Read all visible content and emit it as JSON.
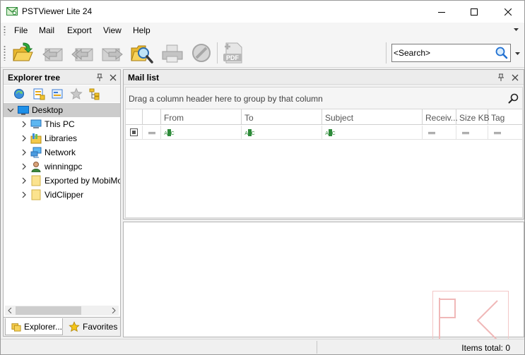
{
  "window": {
    "title": "PSTViewer Lite 24",
    "controls": [
      "minimize-icon",
      "maximize-icon",
      "close-icon"
    ]
  },
  "menu": {
    "items": [
      "File",
      "Mail",
      "Export",
      "View",
      "Help"
    ]
  },
  "toolbar": {
    "buttons": [
      {
        "name": "open-icon",
        "enabled": true
      },
      {
        "name": "reply-icon",
        "enabled": false
      },
      {
        "name": "reply-all-icon",
        "enabled": false
      },
      {
        "name": "forward-icon",
        "enabled": false
      },
      {
        "name": "find-icon",
        "enabled": true
      },
      {
        "name": "print-icon",
        "enabled": false
      },
      {
        "name": "stop-icon",
        "enabled": false
      },
      {
        "name": "export-pdf-icon",
        "enabled": false
      }
    ],
    "pdf_label": "PDF",
    "search": {
      "placeholder": "<Search>",
      "value": ""
    }
  },
  "explorer": {
    "title": "Explorer tree",
    "tools": [
      "refresh-icon",
      "properties-icon",
      "view-icon",
      "favorite-star-icon",
      "tree-icon"
    ],
    "tree": [
      {
        "label": "Desktop",
        "icon": "desktop-icon",
        "expanded": true,
        "selected": true,
        "level": 0
      },
      {
        "label": "This PC",
        "icon": "computer-icon",
        "expanded": false,
        "level": 1
      },
      {
        "label": "Libraries",
        "icon": "libraries-icon",
        "expanded": false,
        "level": 1
      },
      {
        "label": "Network",
        "icon": "network-icon",
        "expanded": false,
        "level": 1
      },
      {
        "label": "winningpc",
        "icon": "user-icon",
        "expanded": false,
        "level": 1
      },
      {
        "label": "Exported by MobiMover",
        "icon": "folder-icon",
        "expanded": false,
        "level": 1
      },
      {
        "label": "VidClipper",
        "icon": "folder-icon",
        "expanded": false,
        "level": 1
      }
    ],
    "tabs": [
      {
        "label": "Explorer...",
        "icon": "explorer-icon",
        "active": true
      },
      {
        "label": "Favorites",
        "icon": "star-icon",
        "active": false
      }
    ]
  },
  "maillist": {
    "title": "Mail list",
    "group_hint": "Drag a column header here to group by that column",
    "columns": [
      "",
      "",
      "From",
      "To",
      "Subject",
      "Receiv...",
      "Size KB",
      "Tag"
    ],
    "filter_row_abc": "ABC"
  },
  "watermark": {
    "text": "PC"
  },
  "status": {
    "items_total": "Items total: 0"
  },
  "colors": {
    "window_bg": "#f0f0f0",
    "selected_row": "#cccccc",
    "accent_green": "#2e8b3a",
    "search_blue": "#1f6fd1"
  }
}
